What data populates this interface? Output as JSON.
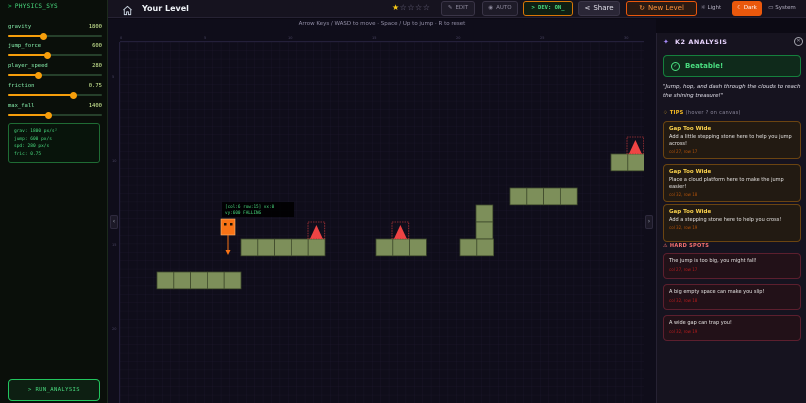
{
  "physics": {
    "title": "PHYSICS_SYS",
    "params": [
      {
        "label": "gravity",
        "value": "1800",
        "level": 0.38
      },
      {
        "label": "jump_force",
        "value": "600",
        "level": 0.42
      },
      {
        "label": "player_speed",
        "value": "280",
        "level": 0.32
      },
      {
        "label": "friction",
        "value": "0.75",
        "level": 0.7
      },
      {
        "label": "max_fall",
        "value": "1400",
        "level": 0.43
      }
    ],
    "stats": [
      "grav: 1800 px/s²",
      "jump: 600 px/s",
      "spd: 280 px/s",
      "fric: 0.75"
    ],
    "run_label": "> RUN_ANALYSIS"
  },
  "topbar": {
    "title": "Your Level",
    "rating": 1,
    "rating_max": 5,
    "edit_label": "EDIT",
    "auto_label": "AUTO",
    "dev_label": "> DEV: ON_",
    "share_label": "Share",
    "new_level_label": "New Level",
    "theme": {
      "light": "Light",
      "dark": "Dark",
      "system": "System"
    }
  },
  "game": {
    "hint": "Arrow Keys / WASD to move · Space / Up to jump · R to reset",
    "debug": {
      "line1": "[col:6 row:15]  vx:0",
      "line2": "vy:600  FALLING"
    },
    "ruler_top": [
      "0",
      "5",
      "10",
      "15",
      "20",
      "25",
      "30"
    ],
    "ruler_left": [
      "5",
      "10",
      "15",
      "20"
    ]
  },
  "analysis": {
    "title": "K2 ANALYSIS",
    "status": "Beatable!",
    "description": "\"Jump, hop, and dash through the clouds to reach the shining treasure!\"",
    "tips_title": "TIPS",
    "tips_sub": "(hover ? on canvas)",
    "tips": [
      {
        "title": "Gap Too Wide",
        "body": "Add a little stepping stone here to help you jump across!",
        "meta": "col 27, row 17"
      },
      {
        "title": "Gap Too Wide",
        "body": "Place a cloud platform here to make the jump easier!",
        "meta": "col 32, row 18"
      },
      {
        "title": "Gap Too Wide",
        "body": "Add a stepping stone here to help you cross!",
        "meta": "col 32, row 19"
      }
    ],
    "hard_title": "HARD SPOTS",
    "hard_spots": [
      {
        "body": "The jump is too big, you might fall!",
        "meta": "col 27, row 17"
      },
      {
        "body": "A big empty space can make you slip!",
        "meta": "col 32, row 18"
      },
      {
        "body": "A wide gap can trap you!",
        "meta": "col 32, row 19"
      }
    ]
  },
  "colors": {
    "accent": "#ea580c",
    "terminal_green": "#4ade80",
    "block_fill": "#7d8f5a",
    "spike": "#ef4444",
    "player": "#f97316"
  }
}
